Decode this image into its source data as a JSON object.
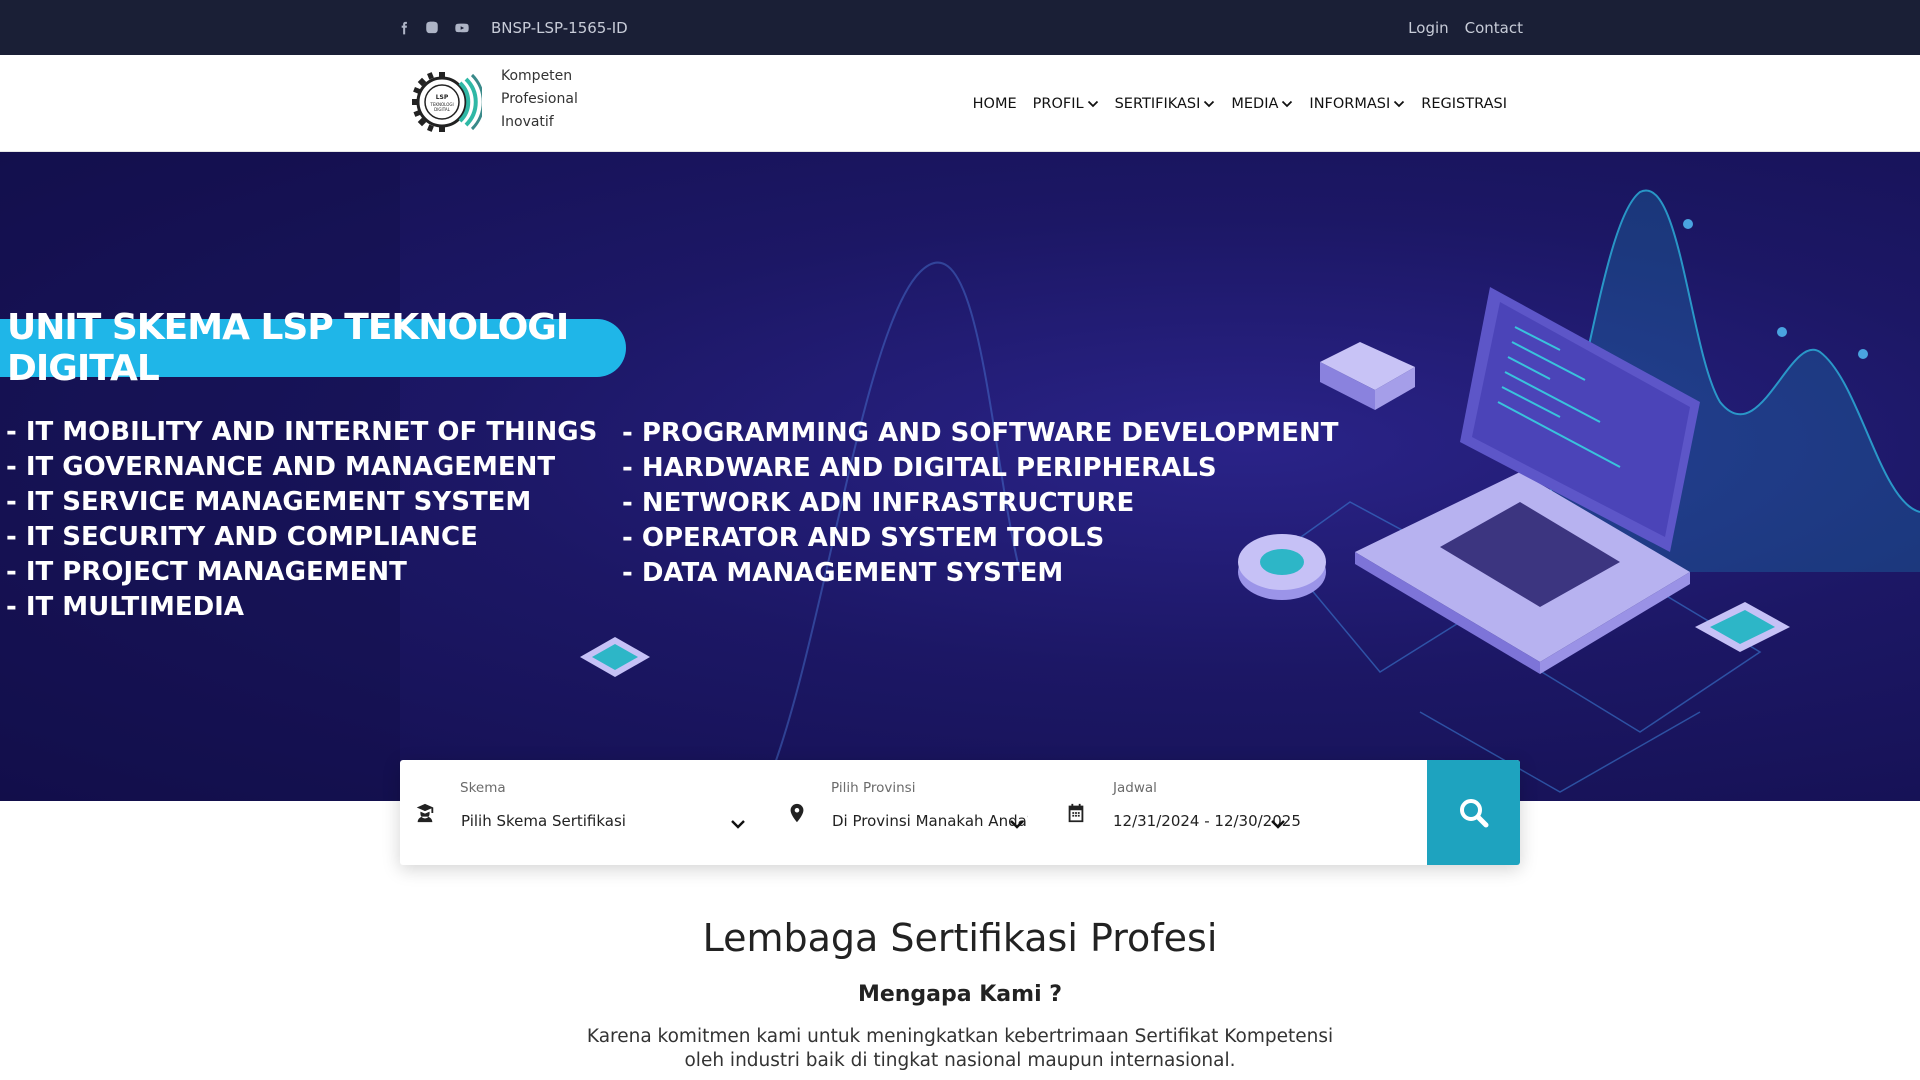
{
  "topbar": {
    "social": [
      "facebook-icon",
      "instagram-icon",
      "youtube-icon"
    ],
    "registration_code": "BNSP-LSP-1565-ID",
    "links": {
      "login": "Login",
      "contact": "Contact"
    }
  },
  "header": {
    "logo_text": "LSP TEKNOLOGI DIGITAL",
    "tagline": [
      "Kompeten",
      "Profesional",
      "Inovatif"
    ],
    "nav": [
      {
        "label": "HOME",
        "dropdown": false
      },
      {
        "label": "PROFIL",
        "dropdown": true
      },
      {
        "label": "SERTIFIKASI",
        "dropdown": true
      },
      {
        "label": "MEDIA",
        "dropdown": true
      },
      {
        "label": "INFORMASI",
        "dropdown": true
      },
      {
        "label": "REGISTRASI",
        "dropdown": false
      }
    ]
  },
  "hero": {
    "title": "UNIT SKEMA LSP TEKNOLOGI DIGITAL",
    "units_left": [
      "- IT MOBILITY AND INTERNET OF THINGS",
      "- IT GOVERNANCE AND MANAGEMENT",
      "- IT SERVICE MANAGEMENT SYSTEM",
      "- IT SECURITY AND COMPLIANCE",
      "- IT PROJECT MANAGEMENT",
      "- IT MULTIMEDIA"
    ],
    "units_right": [
      "- PROGRAMMING AND SOFTWARE DEVELOPMENT",
      "- HARDWARE AND DIGITAL PERIPHERALS",
      "- NETWORK ADN INFRASTRUCTURE",
      "- OPERATOR AND SYSTEM TOOLS",
      "- DATA MANAGEMENT SYSTEM"
    ]
  },
  "search": {
    "skema": {
      "label": "Skema",
      "value": "Pilih Skema Sertifikasi",
      "icon": "graduate-icon"
    },
    "provinsi": {
      "label": "Pilih Provinsi",
      "value": "Di Provinsi Manakah Anda?",
      "icon": "map-pin-icon"
    },
    "jadwal": {
      "label": "Jadwal",
      "value": "12/31/2024 - 12/30/2025",
      "icon": "calendar-icon"
    },
    "button_icon": "search-icon"
  },
  "content": {
    "title": "Lembaga Sertifikasi Profesi",
    "subtitle": "Mengapa Kami ?",
    "paragraph_line1": "Karena komitmen kami untuk meningkatkan kebertrimaan Sertifikat Kompetensi",
    "paragraph_line2": "oleh industri baik di tingkat nasional maupun internasional."
  },
  "colors": {
    "topbar_bg": "#1a1f36",
    "hero_bg": "#1c1765",
    "pill": "#1fb6e8",
    "search_button": "#1ea3bf"
  }
}
